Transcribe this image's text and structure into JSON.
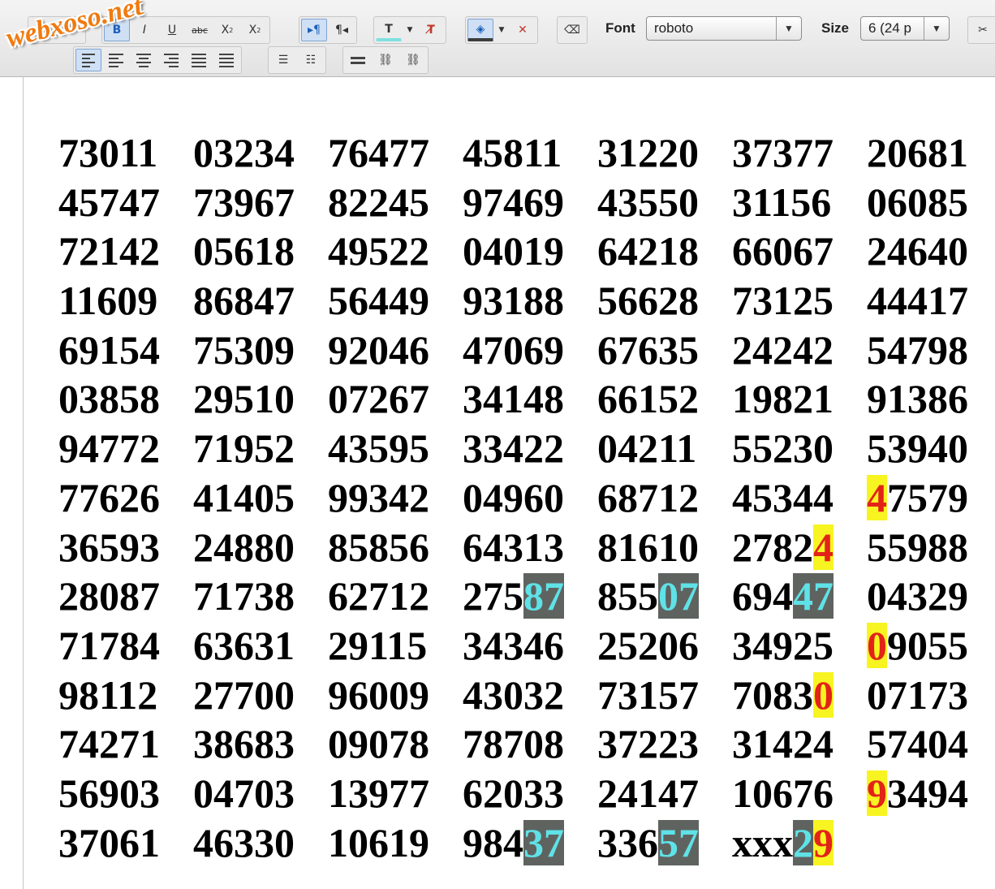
{
  "watermark": "webxoso.net",
  "toolbar": {
    "font_label": "Font",
    "font_value": "roboto",
    "size_label": "Size",
    "size_value": "6 (24 p",
    "dropdown_arrow": "▼"
  },
  "numbers": [
    [
      "73011",
      "03234",
      "76477",
      "45811",
      "31220",
      "37377",
      "20681"
    ],
    [
      "45747",
      "73967",
      "82245",
      "97469",
      "43550",
      "31156",
      "06085"
    ],
    [
      "72142",
      "05618",
      "49522",
      "04019",
      "64218",
      "66067",
      "24640"
    ],
    [
      "11609",
      "86847",
      "56449",
      "93188",
      "56628",
      "73125",
      "44417"
    ],
    [
      "69154",
      "75309",
      "92046",
      "47069",
      "67635",
      "24242",
      "54798"
    ],
    [
      "03858",
      "29510",
      "07267",
      "34148",
      "66152",
      "19821",
      "91386"
    ],
    [
      "94772",
      "71952",
      "43595",
      "33422",
      "04211",
      "55230",
      "53940"
    ],
    [
      "77626",
      "41405",
      "99342",
      "04960",
      "68712",
      "45344",
      "47579"
    ],
    [
      "36593",
      "24880",
      "85856",
      "64313",
      "81610",
      "27824",
      "55988"
    ],
    [
      "28087",
      "71738",
      "62712",
      "27587",
      "85507",
      "69447",
      "04329"
    ],
    [
      "71784",
      "63631",
      "29115",
      "34346",
      "25206",
      "34925",
      "09055"
    ],
    [
      "98112",
      "27700",
      "96009",
      "43032",
      "73157",
      "70830",
      "07173"
    ],
    [
      "74271",
      "38683",
      "09078",
      "78708",
      "37223",
      "31424",
      "57404"
    ],
    [
      "56903",
      "04703",
      "13977",
      "62033",
      "24147",
      "10676",
      "93494"
    ],
    [
      "37061",
      "46330",
      "10619",
      "98437",
      "33657",
      "xxx29",
      ""
    ]
  ],
  "highlights": [
    {
      "row": 7,
      "col": 6,
      "start": 0,
      "end": 1,
      "style": "yellow"
    },
    {
      "row": 8,
      "col": 5,
      "start": 4,
      "end": 5,
      "style": "yellow"
    },
    {
      "row": 9,
      "col": 3,
      "start": 3,
      "end": 5,
      "style": "teal"
    },
    {
      "row": 9,
      "col": 4,
      "start": 3,
      "end": 5,
      "style": "teal"
    },
    {
      "row": 9,
      "col": 5,
      "start": 3,
      "end": 5,
      "style": "teal"
    },
    {
      "row": 10,
      "col": 6,
      "start": 0,
      "end": 1,
      "style": "yellow"
    },
    {
      "row": 11,
      "col": 5,
      "start": 4,
      "end": 5,
      "style": "yellow"
    },
    {
      "row": 13,
      "col": 6,
      "start": 0,
      "end": 1,
      "style": "yellow"
    },
    {
      "row": 14,
      "col": 3,
      "start": 3,
      "end": 5,
      "style": "teal"
    },
    {
      "row": 14,
      "col": 4,
      "start": 3,
      "end": 5,
      "style": "teal"
    },
    {
      "row": 14,
      "col": 5,
      "start": 3,
      "end": 4,
      "style": "teal"
    },
    {
      "row": 14,
      "col": 5,
      "start": 4,
      "end": 5,
      "style": "yellow"
    }
  ],
  "colors": {
    "highlight_yellow_bg": "#f7f421",
    "highlight_yellow_text": "#e22418",
    "highlight_teal_bg": "#5f6360",
    "highlight_teal_text": "#5fe2e7",
    "watermark": "#f07b10"
  }
}
